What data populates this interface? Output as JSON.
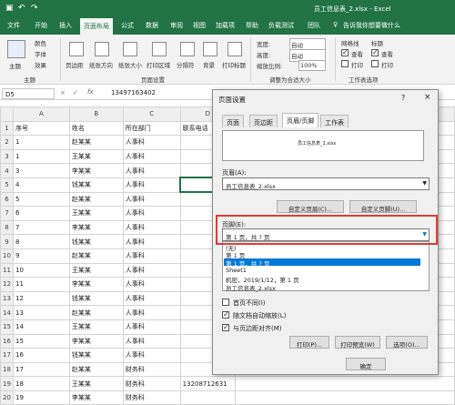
{
  "app": {
    "title": "员工信息表_2.xlsx - Excel"
  },
  "menu": {
    "items": [
      "文件",
      "开始",
      "插入",
      "页面布局",
      "公式",
      "数据",
      "审阅",
      "视图",
      "加载项",
      "帮助",
      "负载测试",
      "团队"
    ],
    "tell_me": "告诉我你想要做什么"
  },
  "ribbon": {
    "themes": {
      "label": "主题",
      "colors": "颜色",
      "fonts": "字体",
      "effects": "效果",
      "group": "主题"
    },
    "page_setup": {
      "margins": "页边距",
      "orientation": "纸张方向",
      "size": "纸张大小",
      "print_area": "打印区域",
      "breaks": "分隔符",
      "background": "背景",
      "print_titles": "打印标题",
      "group": "页面设置"
    },
    "scale": {
      "width_label": "宽度:",
      "width_val": "自动",
      "height_label": "高度:",
      "height_val": "自动",
      "scale_label": "缩放比例:",
      "scale_val": "100%",
      "group": "调整为合适大小"
    },
    "sheet_options": {
      "gridlines": "网格线",
      "headings": "标题",
      "view": "查看",
      "print": "打印",
      "group": "工作表选项"
    }
  },
  "formula": {
    "namebox": "D5",
    "value": "13497163402"
  },
  "grid": {
    "columns": [
      "A",
      "B",
      "C",
      "D"
    ],
    "rows": [
      {
        "n": "1",
        "a": "序号",
        "b": "姓名",
        "c": "所在部门",
        "d": "联系电话"
      },
      {
        "n": "2",
        "a": "1",
        "b": "赵某某",
        "c": "人事科",
        "d": ""
      },
      {
        "n": "3",
        "a": "1",
        "b": "王某某",
        "c": "人事科",
        "d": ""
      },
      {
        "n": "4",
        "a": "3",
        "b": "李某某",
        "c": "人事科",
        "d": ""
      },
      {
        "n": "5",
        "a": "4",
        "b": "钱某某",
        "c": "人事科",
        "d": ""
      },
      {
        "n": "6",
        "a": "5",
        "b": "赵某某",
        "c": "人事科",
        "d": ""
      },
      {
        "n": "7",
        "a": "6",
        "b": "王某某",
        "c": "人事科",
        "d": ""
      },
      {
        "n": "8",
        "a": "7",
        "b": "李某某",
        "c": "人事科",
        "d": ""
      },
      {
        "n": "9",
        "a": "8",
        "b": "钱某某",
        "c": "人事科",
        "d": ""
      },
      {
        "n": "10",
        "a": "9",
        "b": "赵某某",
        "c": "人事科",
        "d": ""
      },
      {
        "n": "11",
        "a": "10",
        "b": "王某某",
        "c": "人事科",
        "d": ""
      },
      {
        "n": "12",
        "a": "11",
        "b": "李某某",
        "c": "人事科",
        "d": ""
      },
      {
        "n": "13",
        "a": "12",
        "b": "钱某某",
        "c": "人事科",
        "d": ""
      },
      {
        "n": "14",
        "a": "13",
        "b": "赵某某",
        "c": "人事科",
        "d": ""
      },
      {
        "n": "15",
        "a": "14",
        "b": "王某某",
        "c": "人事科",
        "d": ""
      },
      {
        "n": "16",
        "a": "15",
        "b": "李某某",
        "c": "人事科",
        "d": ""
      },
      {
        "n": "17",
        "a": "16",
        "b": "钱某某",
        "c": "人事科",
        "d": ""
      },
      {
        "n": "18",
        "a": "17",
        "b": "赵某某",
        "c": "财务科",
        "d": ""
      },
      {
        "n": "19",
        "a": "18",
        "b": "王某某",
        "c": "财务科",
        "d": "13208712631"
      },
      {
        "n": "20",
        "a": "19",
        "b": "李某某",
        "c": "财务科",
        "d": ""
      }
    ]
  },
  "dialog": {
    "title": "页面设置",
    "help": "?",
    "close": "×",
    "tabs": [
      "页面",
      "页边距",
      "页眉/页脚",
      "工作表"
    ],
    "header_preview": "员工信息表_2.xlsx",
    "header_label": "页眉(A):",
    "header_value": "员工信息表_2.xlsx",
    "custom_header": "自定义页眉(C)...",
    "custom_footer": "自定义页脚(U)...",
    "footer_label": "页脚(E):",
    "footer_value": "第 1 页，共 ? 页",
    "footer_options": [
      "(无)",
      "第 1 页",
      "第 1 页，共 ? 页",
      "Sheet1",
      "机密，2019/1/12，第 1 页",
      "员工信息表_2.xlsx"
    ],
    "different_first": "首页不同(I)",
    "scale_with_doc": "随文档自动缩放(L)",
    "align_margins": "与页边距对齐(M)",
    "print": "打印(P)...",
    "print_preview": "打印预览(W)",
    "options": "选项(O)...",
    "ok": "确定"
  },
  "colors": {
    "excel_green": "#217346",
    "highlight": "#e53935",
    "selection": "#0078d7"
  }
}
